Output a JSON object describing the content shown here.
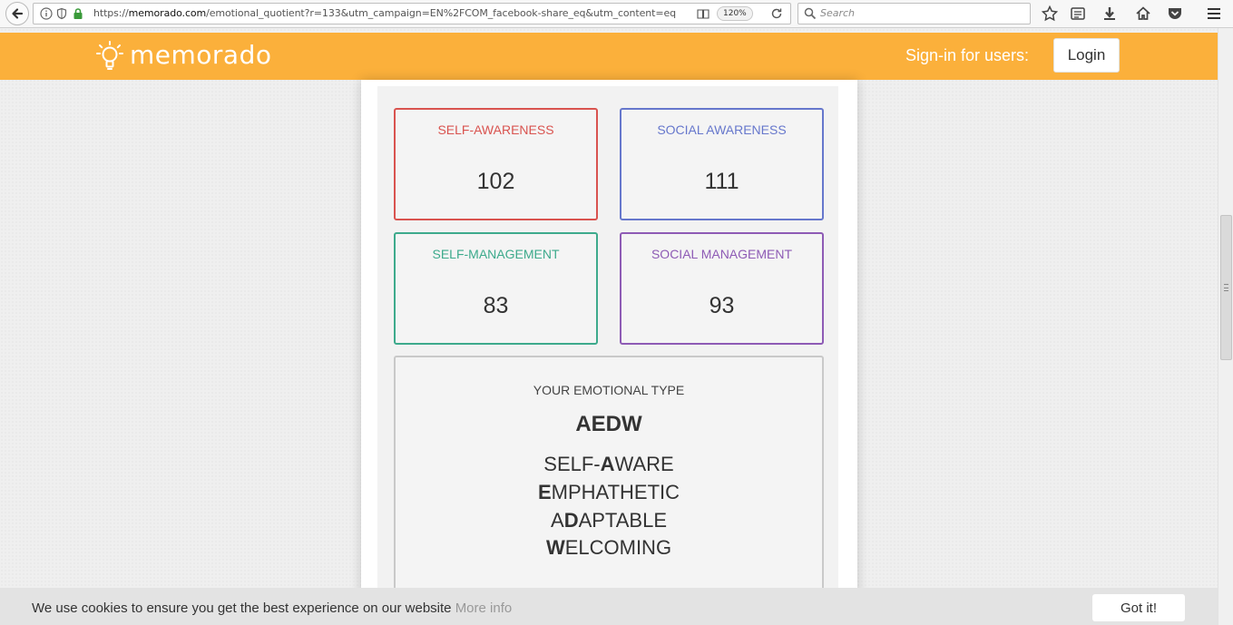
{
  "browser": {
    "url_prefix": "https://",
    "url_domain": "memorado.com",
    "url_path": "/emotional_quotient?r=133&utm_campaign=EN%2FCOM_facebook-share_eq&utm_content=eq",
    "zoom": "120%",
    "search_placeholder": "Search"
  },
  "header": {
    "logo": "memorado",
    "signin_text": "Sign-in for users:",
    "login_label": "Login",
    "accent_color": "#fbb03b"
  },
  "scores": [
    {
      "label": "SELF-AWARENESS",
      "value": "102",
      "color": "#d9534f"
    },
    {
      "label": "SOCIAL AWARENESS",
      "value": "111",
      "color": "#6677cc"
    },
    {
      "label": "SELF-MANAGEMENT",
      "value": "83",
      "color": "#3daa8c"
    },
    {
      "label": "SOCIAL MANAGEMENT",
      "value": "93",
      "color": "#8e5bb5"
    }
  ],
  "emotional_type": {
    "label": "YOUR EMOTIONAL TYPE",
    "code": "AEDW",
    "traits": [
      {
        "pre": "SELF-",
        "letter": "A",
        "post": "WARE"
      },
      {
        "pre": "",
        "letter": "E",
        "post": "MPHATHETIC"
      },
      {
        "pre": "A",
        "letter": "D",
        "post": "APTABLE"
      },
      {
        "pre": "",
        "letter": "W",
        "post": "ELCOMING"
      }
    ]
  },
  "cookie": {
    "message": "We use cookies to ensure you get the best experience on our website",
    "more_info": "More info",
    "button": "Got it!"
  }
}
